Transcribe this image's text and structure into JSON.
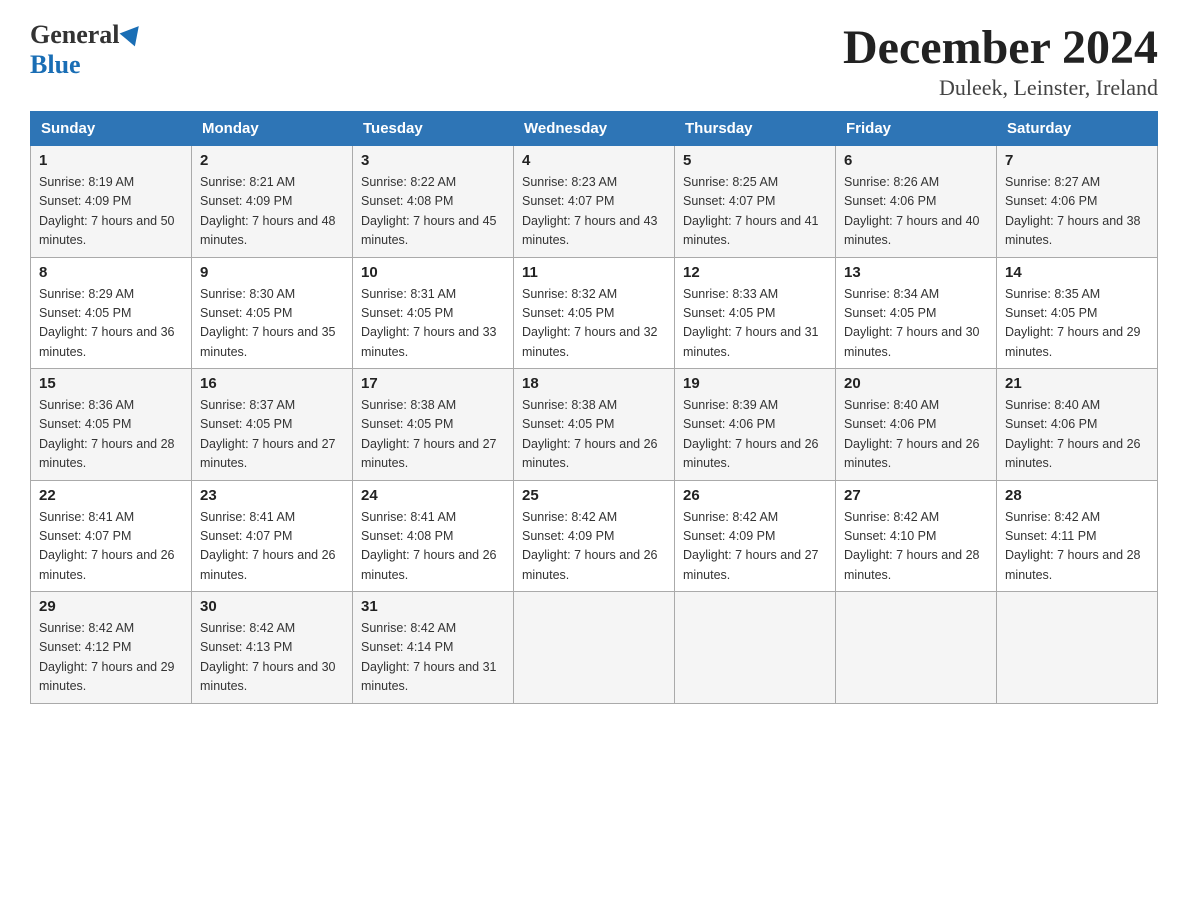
{
  "logo": {
    "general": "General",
    "blue": "Blue"
  },
  "title": "December 2024",
  "location": "Duleek, Leinster, Ireland",
  "headers": [
    "Sunday",
    "Monday",
    "Tuesday",
    "Wednesday",
    "Thursday",
    "Friday",
    "Saturday"
  ],
  "weeks": [
    [
      {
        "day": "1",
        "sunrise": "Sunrise: 8:19 AM",
        "sunset": "Sunset: 4:09 PM",
        "daylight": "Daylight: 7 hours and 50 minutes."
      },
      {
        "day": "2",
        "sunrise": "Sunrise: 8:21 AM",
        "sunset": "Sunset: 4:09 PM",
        "daylight": "Daylight: 7 hours and 48 minutes."
      },
      {
        "day": "3",
        "sunrise": "Sunrise: 8:22 AM",
        "sunset": "Sunset: 4:08 PM",
        "daylight": "Daylight: 7 hours and 45 minutes."
      },
      {
        "day": "4",
        "sunrise": "Sunrise: 8:23 AM",
        "sunset": "Sunset: 4:07 PM",
        "daylight": "Daylight: 7 hours and 43 minutes."
      },
      {
        "day": "5",
        "sunrise": "Sunrise: 8:25 AM",
        "sunset": "Sunset: 4:07 PM",
        "daylight": "Daylight: 7 hours and 41 minutes."
      },
      {
        "day": "6",
        "sunrise": "Sunrise: 8:26 AM",
        "sunset": "Sunset: 4:06 PM",
        "daylight": "Daylight: 7 hours and 40 minutes."
      },
      {
        "day": "7",
        "sunrise": "Sunrise: 8:27 AM",
        "sunset": "Sunset: 4:06 PM",
        "daylight": "Daylight: 7 hours and 38 minutes."
      }
    ],
    [
      {
        "day": "8",
        "sunrise": "Sunrise: 8:29 AM",
        "sunset": "Sunset: 4:05 PM",
        "daylight": "Daylight: 7 hours and 36 minutes."
      },
      {
        "day": "9",
        "sunrise": "Sunrise: 8:30 AM",
        "sunset": "Sunset: 4:05 PM",
        "daylight": "Daylight: 7 hours and 35 minutes."
      },
      {
        "day": "10",
        "sunrise": "Sunrise: 8:31 AM",
        "sunset": "Sunset: 4:05 PM",
        "daylight": "Daylight: 7 hours and 33 minutes."
      },
      {
        "day": "11",
        "sunrise": "Sunrise: 8:32 AM",
        "sunset": "Sunset: 4:05 PM",
        "daylight": "Daylight: 7 hours and 32 minutes."
      },
      {
        "day": "12",
        "sunrise": "Sunrise: 8:33 AM",
        "sunset": "Sunset: 4:05 PM",
        "daylight": "Daylight: 7 hours and 31 minutes."
      },
      {
        "day": "13",
        "sunrise": "Sunrise: 8:34 AM",
        "sunset": "Sunset: 4:05 PM",
        "daylight": "Daylight: 7 hours and 30 minutes."
      },
      {
        "day": "14",
        "sunrise": "Sunrise: 8:35 AM",
        "sunset": "Sunset: 4:05 PM",
        "daylight": "Daylight: 7 hours and 29 minutes."
      }
    ],
    [
      {
        "day": "15",
        "sunrise": "Sunrise: 8:36 AM",
        "sunset": "Sunset: 4:05 PM",
        "daylight": "Daylight: 7 hours and 28 minutes."
      },
      {
        "day": "16",
        "sunrise": "Sunrise: 8:37 AM",
        "sunset": "Sunset: 4:05 PM",
        "daylight": "Daylight: 7 hours and 27 minutes."
      },
      {
        "day": "17",
        "sunrise": "Sunrise: 8:38 AM",
        "sunset": "Sunset: 4:05 PM",
        "daylight": "Daylight: 7 hours and 27 minutes."
      },
      {
        "day": "18",
        "sunrise": "Sunrise: 8:38 AM",
        "sunset": "Sunset: 4:05 PM",
        "daylight": "Daylight: 7 hours and 26 minutes."
      },
      {
        "day": "19",
        "sunrise": "Sunrise: 8:39 AM",
        "sunset": "Sunset: 4:06 PM",
        "daylight": "Daylight: 7 hours and 26 minutes."
      },
      {
        "day": "20",
        "sunrise": "Sunrise: 8:40 AM",
        "sunset": "Sunset: 4:06 PM",
        "daylight": "Daylight: 7 hours and 26 minutes."
      },
      {
        "day": "21",
        "sunrise": "Sunrise: 8:40 AM",
        "sunset": "Sunset: 4:06 PM",
        "daylight": "Daylight: 7 hours and 26 minutes."
      }
    ],
    [
      {
        "day": "22",
        "sunrise": "Sunrise: 8:41 AM",
        "sunset": "Sunset: 4:07 PM",
        "daylight": "Daylight: 7 hours and 26 minutes."
      },
      {
        "day": "23",
        "sunrise": "Sunrise: 8:41 AM",
        "sunset": "Sunset: 4:07 PM",
        "daylight": "Daylight: 7 hours and 26 minutes."
      },
      {
        "day": "24",
        "sunrise": "Sunrise: 8:41 AM",
        "sunset": "Sunset: 4:08 PM",
        "daylight": "Daylight: 7 hours and 26 minutes."
      },
      {
        "day": "25",
        "sunrise": "Sunrise: 8:42 AM",
        "sunset": "Sunset: 4:09 PM",
        "daylight": "Daylight: 7 hours and 26 minutes."
      },
      {
        "day": "26",
        "sunrise": "Sunrise: 8:42 AM",
        "sunset": "Sunset: 4:09 PM",
        "daylight": "Daylight: 7 hours and 27 minutes."
      },
      {
        "day": "27",
        "sunrise": "Sunrise: 8:42 AM",
        "sunset": "Sunset: 4:10 PM",
        "daylight": "Daylight: 7 hours and 28 minutes."
      },
      {
        "day": "28",
        "sunrise": "Sunrise: 8:42 AM",
        "sunset": "Sunset: 4:11 PM",
        "daylight": "Daylight: 7 hours and 28 minutes."
      }
    ],
    [
      {
        "day": "29",
        "sunrise": "Sunrise: 8:42 AM",
        "sunset": "Sunset: 4:12 PM",
        "daylight": "Daylight: 7 hours and 29 minutes."
      },
      {
        "day": "30",
        "sunrise": "Sunrise: 8:42 AM",
        "sunset": "Sunset: 4:13 PM",
        "daylight": "Daylight: 7 hours and 30 minutes."
      },
      {
        "day": "31",
        "sunrise": "Sunrise: 8:42 AM",
        "sunset": "Sunset: 4:14 PM",
        "daylight": "Daylight: 7 hours and 31 minutes."
      },
      null,
      null,
      null,
      null
    ]
  ]
}
